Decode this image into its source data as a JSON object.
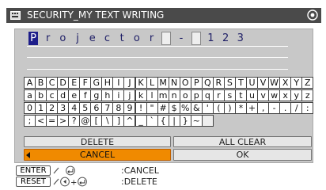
{
  "window": {
    "title": "SECURITY_MY TEXT WRITING",
    "icon": "keyboard-icon",
    "close_icon": "close-icon"
  },
  "entry": {
    "characters": [
      "P",
      "r",
      "o",
      "j",
      "e",
      "c",
      "t",
      "o",
      "r",
      "□",
      "-",
      "□",
      "1",
      "2",
      "3"
    ],
    "cursor_index": 0
  },
  "keyboard": {
    "rows": [
      [
        "A",
        "B",
        "C",
        "D",
        "E",
        "F",
        "G",
        "H",
        "I",
        "J",
        "K",
        "L",
        "M",
        "N",
        "O",
        "P",
        "Q",
        "R",
        "S",
        "T",
        "U",
        "V",
        "W",
        "X",
        "Y",
        "Z"
      ],
      [
        "a",
        "b",
        "c",
        "d",
        "e",
        "f",
        "g",
        "h",
        "i",
        "j",
        "k",
        "l",
        "m",
        "n",
        "o",
        "p",
        "q",
        "r",
        "s",
        "t",
        "u",
        "v",
        "w",
        "x",
        "y",
        "z"
      ],
      [
        "0",
        "1",
        "2",
        "3",
        "4",
        "5",
        "6",
        "7",
        "8",
        "9",
        "!",
        "\"",
        "#",
        "$",
        "%",
        "&",
        "'",
        "(",
        ")",
        "*",
        "+",
        ",",
        "-",
        ".",
        "/",
        ":"
      ],
      [
        ";",
        "<",
        "=",
        ">",
        "?",
        "@",
        "[",
        "\\",
        "]",
        "^",
        "_",
        "`",
        "{",
        "|",
        "}",
        "~",
        "□"
      ]
    ]
  },
  "buttons": {
    "delete": "DELETE",
    "all_clear": "ALL CLEAR",
    "cancel": "CANCEL",
    "ok": "OK"
  },
  "help": {
    "enter_key": "ENTER",
    "enter_desc": ":CANCEL",
    "reset_key": "RESET",
    "reset_desc": ":DELETE"
  },
  "colors": {
    "title_bg": "#4a4a4a",
    "selected": "#f08a00",
    "cursor_bg": "#1e1e8a"
  }
}
